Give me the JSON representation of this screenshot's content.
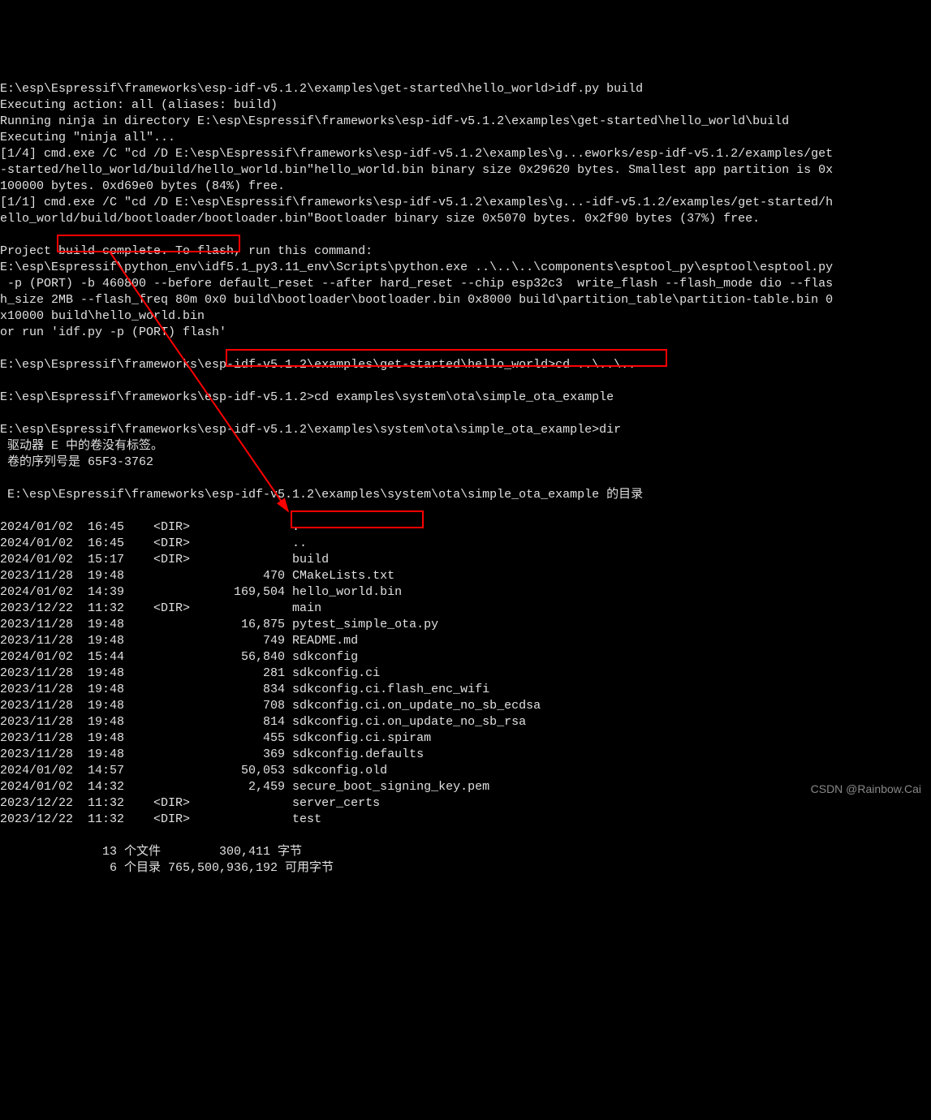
{
  "lines": {
    "l1": "E:\\esp\\Espressif\\frameworks\\esp-idf-v5.1.2\\examples\\get-started\\hello_world>idf.py build",
    "l2": "Executing action: all (aliases: build)",
    "l3": "Running ninja in directory E:\\esp\\Espressif\\frameworks\\esp-idf-v5.1.2\\examples\\get-started\\hello_world\\build",
    "l4": "Executing \"ninja all\"...",
    "l5": "[1/4] cmd.exe /C \"cd /D E:\\esp\\Espressif\\frameworks\\esp-idf-v5.1.2\\examples\\g...eworks/esp-idf-v5.1.2/examples/get",
    "l6": "-started/hello_world/build/hello_world.bin\"hello_world.bin binary size 0x29620 bytes. Smallest app partition is 0x",
    "l7": "100000 bytes. 0xd69e0 bytes (84%) free.",
    "l8": "[1/1] cmd.exe /C \"cd /D E:\\esp\\Espressif\\frameworks\\esp-idf-v5.1.2\\examples\\g...-idf-v5.1.2/examples/get-started/h",
    "l9": "ello_world/build/bootloader/bootloader.bin\"Bootloader binary size 0x5070 bytes. 0x2f90 bytes (37%) free.",
    "l10": "",
    "l11": "Project build complete. To flash, run this command:",
    "l12": "E:\\esp\\Espressif\\python_env\\idf5.1_py3.11_env\\Scripts\\python.exe ..\\..\\..\\components\\esptool_py\\esptool\\esptool.py",
    "l13": " -p (PORT) -b 460800 --before default_reset --after hard_reset --chip esp32c3  write_flash --flash_mode dio --flas",
    "l14": "h_size 2MB --flash_freq 80m 0x0 build\\bootloader\\bootloader.bin 0x8000 build\\partition_table\\partition-table.bin 0",
    "l15": "x10000 build\\hello_world.bin",
    "l16": "or run 'idf.py -p (PORT) flash'",
    "l17": "",
    "l18": "E:\\esp\\Espressif\\frameworks\\esp-idf-v5.1.2\\examples\\get-started\\hello_world>cd ..\\..\\..",
    "l19": "",
    "l20": "E:\\esp\\Espressif\\frameworks\\esp-idf-v5.1.2>cd examples\\system\\ota\\simple_ota_example",
    "l21": "",
    "l22": "E:\\esp\\Espressif\\frameworks\\esp-idf-v5.1.2\\examples\\system\\ota\\simple_ota_example>dir",
    "l23": " 驱动器 E 中的卷没有标签。",
    "l24": " 卷的序列号是 65F3-3762",
    "l25": "",
    "l26": " E:\\esp\\Espressif\\frameworks\\esp-idf-v5.1.2\\examples\\system\\ota\\simple_ota_example 的目录",
    "l27": ""
  },
  "dir_listing": [
    {
      "date": "2024/01/02",
      "time": "16:45",
      "type": "<DIR>",
      "size": "",
      "name": "."
    },
    {
      "date": "2024/01/02",
      "time": "16:45",
      "type": "<DIR>",
      "size": "",
      "name": ".."
    },
    {
      "date": "2024/01/02",
      "time": "15:17",
      "type": "<DIR>",
      "size": "",
      "name": "build"
    },
    {
      "date": "2023/11/28",
      "time": "19:48",
      "type": "",
      "size": "470",
      "name": "CMakeLists.txt"
    },
    {
      "date": "2024/01/02",
      "time": "14:39",
      "type": "",
      "size": "169,504",
      "name": "hello_world.bin"
    },
    {
      "date": "2023/12/22",
      "time": "11:32",
      "type": "<DIR>",
      "size": "",
      "name": "main"
    },
    {
      "date": "2023/11/28",
      "time": "19:48",
      "type": "",
      "size": "16,875",
      "name": "pytest_simple_ota.py"
    },
    {
      "date": "2023/11/28",
      "time": "19:48",
      "type": "",
      "size": "749",
      "name": "README.md"
    },
    {
      "date": "2024/01/02",
      "time": "15:44",
      "type": "",
      "size": "56,840",
      "name": "sdkconfig"
    },
    {
      "date": "2023/11/28",
      "time": "19:48",
      "type": "",
      "size": "281",
      "name": "sdkconfig.ci"
    },
    {
      "date": "2023/11/28",
      "time": "19:48",
      "type": "",
      "size": "834",
      "name": "sdkconfig.ci.flash_enc_wifi"
    },
    {
      "date": "2023/11/28",
      "time": "19:48",
      "type": "",
      "size": "708",
      "name": "sdkconfig.ci.on_update_no_sb_ecdsa"
    },
    {
      "date": "2023/11/28",
      "time": "19:48",
      "type": "",
      "size": "814",
      "name": "sdkconfig.ci.on_update_no_sb_rsa"
    },
    {
      "date": "2023/11/28",
      "time": "19:48",
      "type": "",
      "size": "455",
      "name": "sdkconfig.ci.spiram"
    },
    {
      "date": "2023/11/28",
      "time": "19:48",
      "type": "",
      "size": "369",
      "name": "sdkconfig.defaults"
    },
    {
      "date": "2024/01/02",
      "time": "14:57",
      "type": "",
      "size": "50,053",
      "name": "sdkconfig.old"
    },
    {
      "date": "2024/01/02",
      "time": "14:32",
      "type": "",
      "size": "2,459",
      "name": "secure_boot_signing_key.pem"
    },
    {
      "date": "2023/12/22",
      "time": "11:32",
      "type": "<DIR>",
      "size": "",
      "name": "server_certs"
    },
    {
      "date": "2023/12/22",
      "time": "11:32",
      "type": "<DIR>",
      "size": "",
      "name": "test"
    }
  ],
  "summary": {
    "files_line": "              13 个文件        300,411 字节",
    "dirs_line": "               6 个目录 765,500,936,192 可用字节"
  },
  "watermark": "CSDN @Rainbow.Cai"
}
